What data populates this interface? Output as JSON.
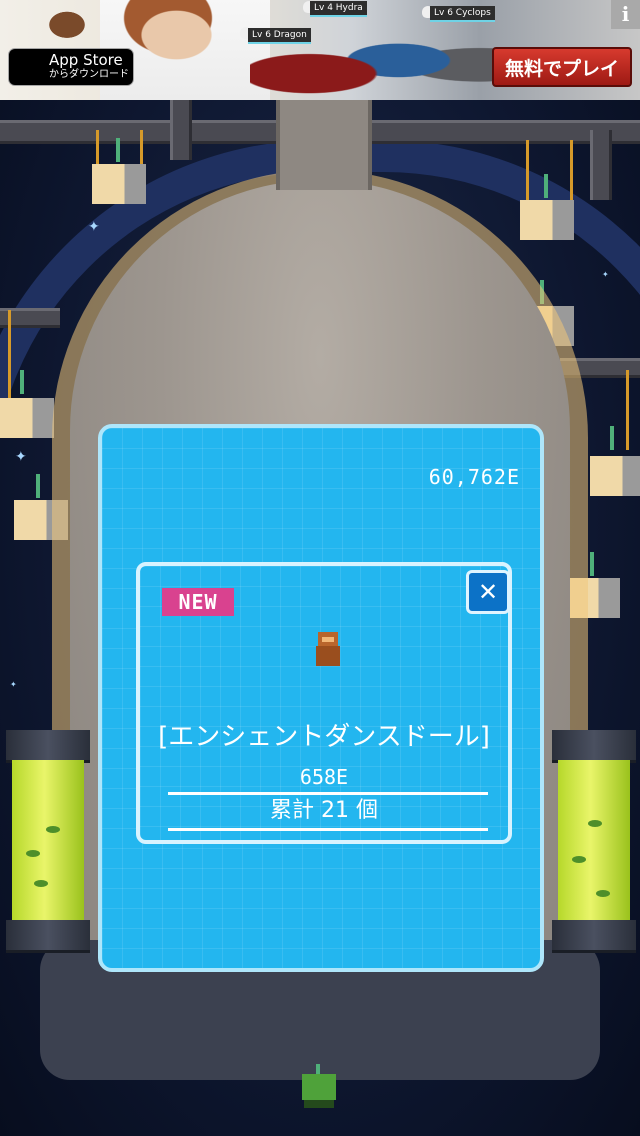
{
  "ad": {
    "appstore_line1": "App Store",
    "appstore_line2": "からダウンロード",
    "monster_tags": [
      "Lv 4 Hydra",
      "Lv 6 Cyclops",
      "Lv 6 Dragon"
    ],
    "cta_label": "無料でプレイ",
    "info_label": "i"
  },
  "game": {
    "currency": "60,762E",
    "dialog": {
      "new_label": "NEW",
      "close_label": "✕",
      "item_name": "[エンシェントダンスドール]",
      "item_price": "658E",
      "item_count": "累計 21 個"
    }
  },
  "colors": {
    "panel": "#23b6ef",
    "panel_border": "#aee6fb",
    "new_badge": "#d9428f",
    "close_button": "#0c72c7",
    "ad_cta": "#c22b22"
  },
  "icons": {
    "close": "close-icon",
    "apple": "apple-icon",
    "info": "info-icon"
  }
}
